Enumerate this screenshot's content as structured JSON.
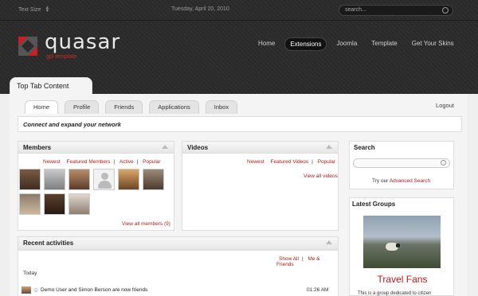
{
  "topbar": {
    "text_size": "Text Size",
    "date": "Tuesday, April 20, 2010",
    "search_placeholder": "search..."
  },
  "logo": {
    "name": "quasar",
    "sub": "gpl template"
  },
  "nav": [
    "Home",
    "Extensions",
    "Joomla",
    "Template",
    "Get Your Skins"
  ],
  "nav_active": 1,
  "section_tab": "Top Tab Content",
  "tabs": [
    "Home",
    "Profile",
    "Friends",
    "Applications",
    "Inbox"
  ],
  "logout": "Logout",
  "connect": "Connect and expand your network",
  "members": {
    "title": "Members",
    "filters": [
      "Newest",
      "Featured Members",
      "Active",
      "Popular"
    ],
    "view_all": "View all members (9)"
  },
  "videos": {
    "title": "Videos",
    "filters": [
      "Newest",
      "Featured Videos",
      "Popular"
    ],
    "view_all": "View all videos"
  },
  "recent": {
    "title": "Recent activities",
    "show_all": "Show All",
    "me_friends": "Me & Friends",
    "today": "Today",
    "activity": "Demo User and Simon Berson are now friends",
    "time": "01:26 AM"
  },
  "search_box": {
    "title": "Search",
    "try": "Try our",
    "advanced": "Advanced Search"
  },
  "latest_groups": {
    "title": "Latest Groups",
    "group": "Travel Fans",
    "desc": "This is a group dedicated to citizen"
  },
  "colors": {
    "accent_red": "#b01a1a",
    "header_bg": "#2b2b2b"
  }
}
